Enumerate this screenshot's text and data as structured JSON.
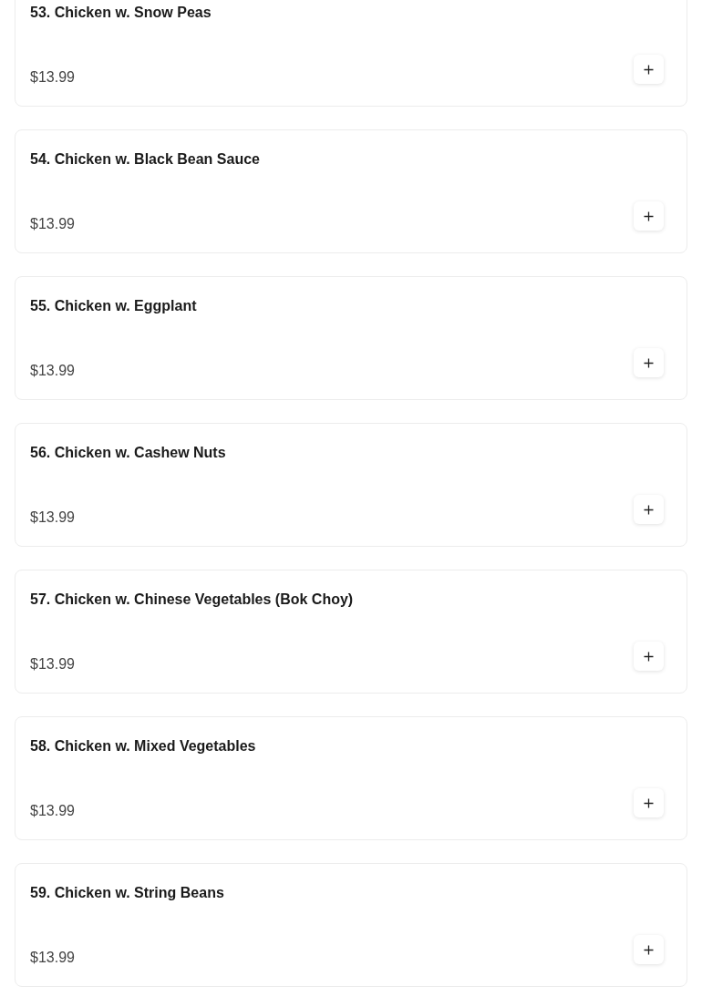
{
  "menu_items": [
    {
      "name": "53. Chicken w. Snow Peas",
      "price": "$13.99"
    },
    {
      "name": "54. Chicken w. Black Bean Sauce",
      "price": "$13.99"
    },
    {
      "name": "55. Chicken w. Eggplant",
      "price": "$13.99"
    },
    {
      "name": "56. Chicken w. Cashew Nuts",
      "price": "$13.99"
    },
    {
      "name": "57. Chicken w. Chinese Vegetables (Bok Choy)",
      "price": "$13.99"
    },
    {
      "name": "58. Chicken w. Mixed Vegetables",
      "price": "$13.99"
    },
    {
      "name": "59. Chicken w. String Beans",
      "price": "$13.99"
    }
  ]
}
